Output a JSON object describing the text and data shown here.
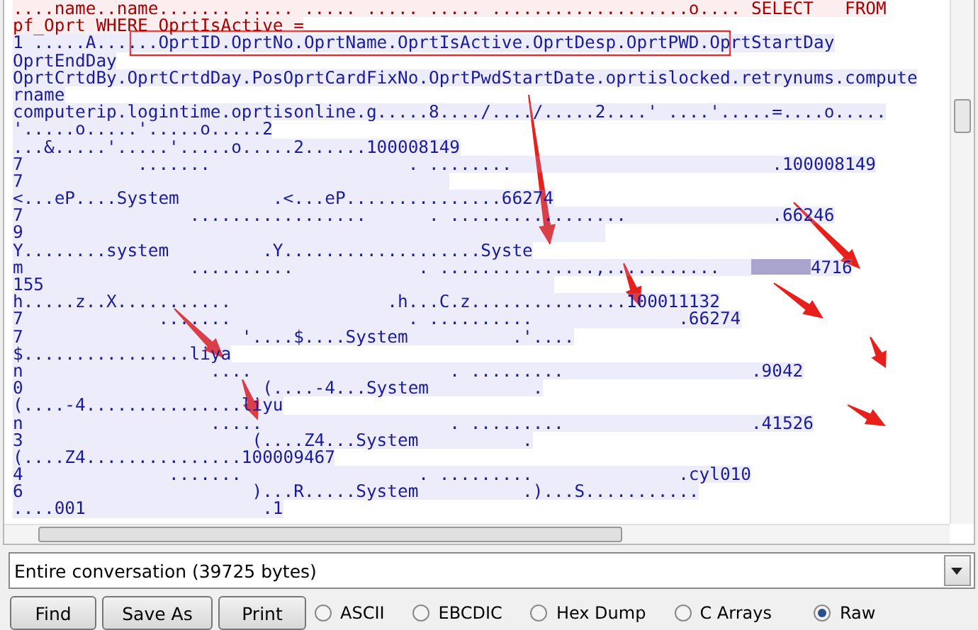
{
  "stream": {
    "lines": [
      {
        "kind": "client",
        "text": "....name..name....... ..... ..... ..... ..... ...................o.... SELECT   FROM"
      },
      {
        "kind": "client",
        "text": "pf_Oprt WHERE OprtIsActive ="
      },
      {
        "kind": "server",
        "text": "1 .....A......OprtID.OprtNo.OprtName.OprtIsActive.OprtDesp.OprtPWD.OprtStartDay"
      },
      {
        "kind": "server",
        "text": "OprtEndDay"
      },
      {
        "kind": "server",
        "text": "OprtCrtdBy.OprtCrtdDay.PosOprtCardFixNo.OprtPwdStartDate.oprtislocked.retrynums.compute"
      },
      {
        "kind": "server",
        "text": "rname"
      },
      {
        "kind": "server",
        "text": "computerip.logintime.oprtisonline.g.....8..../..../.....2....' ....'.....=....o....."
      },
      {
        "kind": "server",
        "text": "'.....o.....'.....o.....2"
      },
      {
        "kind": "server",
        "text": "...&.....'.....'.....o.....2......100008149"
      },
      {
        "kind": "server",
        "text": "7           .......                   . ........                         .100008149"
      },
      {
        "kind": "server",
        "text": "7                                         "
      },
      {
        "kind": "server",
        "text": "<...eP....System         .<...eP...............66274"
      },
      {
        "kind": "server",
        "text": "7                .................      . .................              .66246"
      },
      {
        "kind": "server",
        "text": "9                                                        "
      },
      {
        "kind": "server",
        "text": "Y........system         .Y...................Syste"
      },
      {
        "kind": "server",
        "text": "m                ..........            . ...............,...........   ",
        "redacted_tail": "4716"
      },
      {
        "kind": "server",
        "text": "155                                                 "
      },
      {
        "kind": "server",
        "text": "h.....z..X...........               .h...C.z...............100011132"
      },
      {
        "kind": "server",
        "text": "7             .......                 . ..........              .66274"
      },
      {
        "kind": "server",
        "text": "7                     '....$....System          .'...."
      },
      {
        "kind": "server",
        "text": "$................liya"
      },
      {
        "kind": "server",
        "text": "n                  ....                   . .........                  .9042"
      },
      {
        "kind": "server",
        "text": "0                       (....-4...System          ."
      },
      {
        "kind": "server",
        "text": "(....-4...............liyu"
      },
      {
        "kind": "server",
        "text": "n                  .....                  . .........                  .41526"
      },
      {
        "kind": "server",
        "text": "3                      (....Z4...System          ."
      },
      {
        "kind": "server",
        "text": "(....Z4...............100009467"
      },
      {
        "kind": "server",
        "text": "4              .......                 . .........              .cyl010"
      },
      {
        "kind": "server",
        "text": "6                      )...R.....System          .)...S..........."
      },
      {
        "kind": "server",
        "text": "....001                 .1"
      }
    ]
  },
  "conversation": {
    "value": "Entire conversation (39725 bytes)"
  },
  "buttons": [
    {
      "label": "Find"
    },
    {
      "label": "Save As"
    },
    {
      "label": "Print"
    }
  ],
  "formats": [
    {
      "label": "ASCII",
      "selected": false
    },
    {
      "label": "EBCDIC",
      "selected": false
    },
    {
      "label": "Hex Dump",
      "selected": false
    },
    {
      "label": "C Arrays",
      "selected": false
    },
    {
      "label": "Raw",
      "selected": true
    }
  ]
}
